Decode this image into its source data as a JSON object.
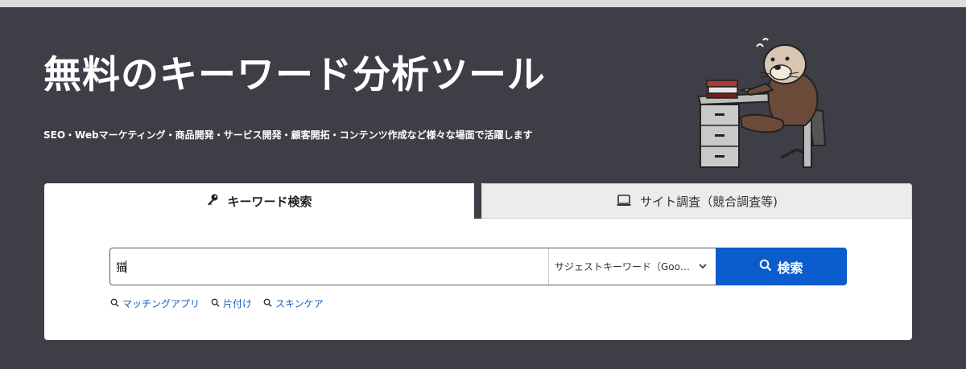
{
  "hero": {
    "title": "無料のキーワード分析ツール",
    "subtitle": "SEO・Webマーケティング・商品開発・サービス開発・顧客開拓・コンテンツ作成など様々な場面で活躍します"
  },
  "tabs": [
    {
      "label": "キーワード検索",
      "icon": "key-icon",
      "active": true
    },
    {
      "label": "サイト調査（競合調査等)",
      "icon": "laptop-icon",
      "active": false
    }
  ],
  "search": {
    "value": "猫",
    "mode": "サジェストキーワード（Google サジェスト）",
    "button_label": "検索"
  },
  "suggestions": [
    {
      "label": "マッチングアプリ",
      "icon": "search-icon"
    },
    {
      "label": "片付け",
      "icon": "search-icon"
    },
    {
      "label": "スキンケア",
      "icon": "search-icon"
    }
  ],
  "colors": {
    "background": "#3e3e46",
    "accent": "#0b5ccc",
    "link": "#1a5cbf"
  }
}
